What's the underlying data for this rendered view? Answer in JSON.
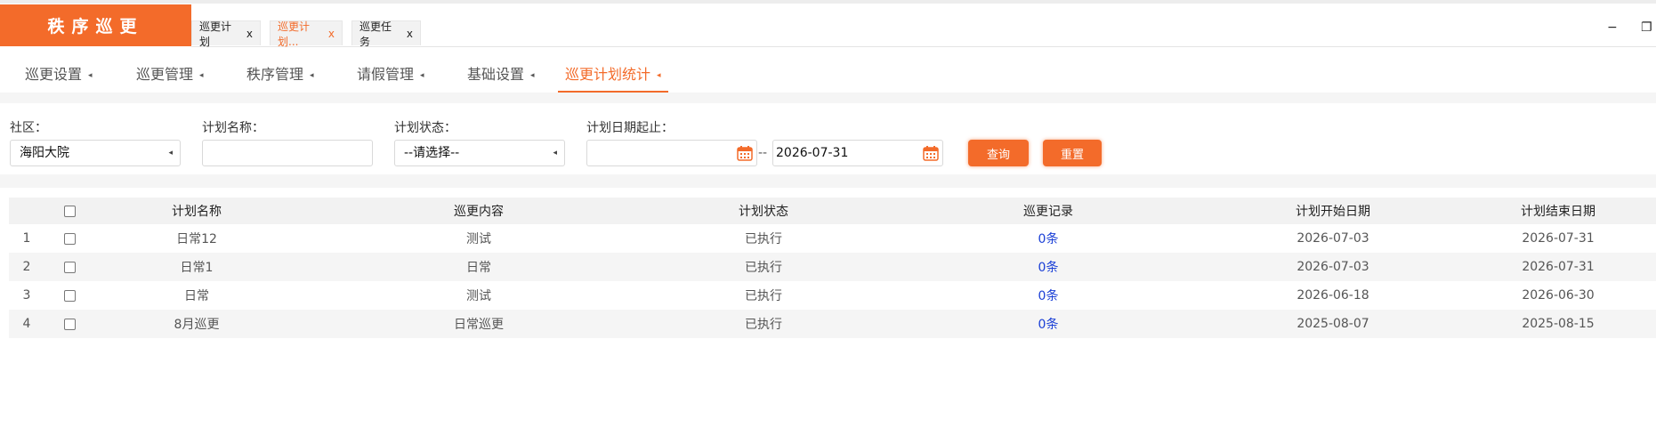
{
  "app": {
    "title": "秩序巡更"
  },
  "tabs": [
    {
      "label": "巡更计划",
      "close": "x"
    },
    {
      "label": "巡更计划...",
      "close": "x"
    },
    {
      "label": "巡更任务",
      "close": "x"
    }
  ],
  "window": {
    "minimize": "−",
    "restore": "❐"
  },
  "menu": [
    {
      "label": "巡更设置"
    },
    {
      "label": "巡更管理"
    },
    {
      "label": "秩序管理"
    },
    {
      "label": "请假管理"
    },
    {
      "label": "基础设置"
    },
    {
      "label": "巡更计划统计"
    }
  ],
  "caret": "◂",
  "filters": {
    "community_label": "社区：",
    "community_value": "海阳大院",
    "plan_name_label": "计划名称：",
    "plan_name_value": "",
    "status_label": "计划状态：",
    "status_value": "--请选择--",
    "date_label": "计划日期起止：",
    "date_start": "",
    "date_sep": "--",
    "date_end": "2026-07-31",
    "query_button": "查询",
    "reset_button": "重置"
  },
  "table": {
    "headers": [
      "计划名称",
      "巡更内容",
      "计划状态",
      "巡更记录",
      "计划开始日期",
      "计划结束日期"
    ],
    "rows": [
      {
        "no": "1",
        "name": "日常12",
        "content": "测试",
        "status": "已执行",
        "record": "0条",
        "start": "2026-07-03",
        "end": "2026-07-31"
      },
      {
        "no": "2",
        "name": "日常1",
        "content": "日常",
        "status": "已执行",
        "record": "0条",
        "start": "2026-07-03",
        "end": "2026-07-31"
      },
      {
        "no": "3",
        "name": "日常",
        "content": "测试",
        "status": "已执行",
        "record": "0条",
        "start": "2026-06-18",
        "end": "2026-06-30"
      },
      {
        "no": "4",
        "name": "8月巡更",
        "content": "日常巡更",
        "status": "已执行",
        "record": "0条",
        "start": "2025-08-07",
        "end": "2025-08-15"
      }
    ]
  },
  "colors": {
    "accent": "#f36b2a",
    "link": "#1a3fd6"
  }
}
